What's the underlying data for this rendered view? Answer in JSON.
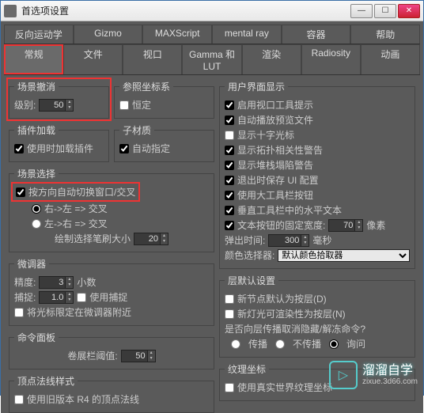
{
  "window": {
    "title": "首选项设置"
  },
  "tabs_row1": [
    "反向运动学",
    "Gizmo",
    "MAXScript",
    "mental ray",
    "容器",
    "帮助"
  ],
  "tabs_row2": [
    "常规",
    "文件",
    "视口",
    "Gamma 和 LUT",
    "渲染",
    "Radiosity",
    "动画"
  ],
  "active_tab": "常规",
  "scene_undo": {
    "legend": "场景撤消",
    "level_label": "级别:",
    "level": "50"
  },
  "ref_coord": {
    "legend": "参照坐标系",
    "constant": "恒定"
  },
  "plugin_load": {
    "legend": "插件加载",
    "load_on_use": "使用时加载插件"
  },
  "sub_mtl": {
    "legend": "子材质",
    "auto_assign": "自动指定"
  },
  "scene_select": {
    "legend": "场景选择",
    "auto_switch": "按方向自动切换窗口/交叉",
    "rtl": "右->左 => 交叉",
    "ltr": "左->右 => 交叉",
    "brush_label": "绘制选择笔刷大小",
    "brush": "20"
  },
  "spinner_grp": {
    "legend": "微调器",
    "precision_label": "精度:",
    "precision": "3",
    "decimal": "小数",
    "snap_label": "捕捉:",
    "snap": "1.0",
    "use_snap": "使用捕捉",
    "cursor_lock": "将光标限定在微调器附近"
  },
  "cmd_panel": {
    "legend": "命令面板",
    "roll_label": "卷展栏阈值:",
    "roll": "50"
  },
  "vertex_norm": {
    "legend": "顶点法线样式",
    "use_r4": "使用旧版本 R4 的顶点法线"
  },
  "ui_display": {
    "legend": "用户界面显示",
    "items": [
      {
        "label": "启用视口工具提示",
        "checked": true
      },
      {
        "label": "自动播放预览文件",
        "checked": true
      },
      {
        "label": "显示十字光标",
        "checked": false
      },
      {
        "label": "显示拓扑相关性警告",
        "checked": true
      },
      {
        "label": "显示堆栈塌陷警告",
        "checked": true
      },
      {
        "label": "退出时保存 UI 配置",
        "checked": true
      },
      {
        "label": "使用大工具栏按钮",
        "checked": true
      },
      {
        "label": "垂直工具栏中的水平文本",
        "checked": true
      },
      {
        "label": "文本按钮的固定宽度:",
        "checked": true
      }
    ],
    "fixed_width": "70",
    "px": "像素",
    "popup_label": "弹出时间:",
    "popup": "300",
    "ms": "毫秒",
    "picker_label": "颜色选择器:",
    "picker": "默认颜色拾取器"
  },
  "layer_def": {
    "legend": "层默认设置",
    "new_node": "新节点默认为按层(D)",
    "new_light": "新灯光可渲染性为按层(N)",
    "question": "是否向层传播取消隐藏/解冻命令?",
    "opts": [
      "传播",
      "不传播",
      "询问"
    ]
  },
  "tex_coord": {
    "legend": "纹理坐标",
    "use_real": "使用真实世界纹理坐标"
  },
  "watermark": {
    "brand": "溜溜自学",
    "url": "zixue.3d66.com"
  }
}
